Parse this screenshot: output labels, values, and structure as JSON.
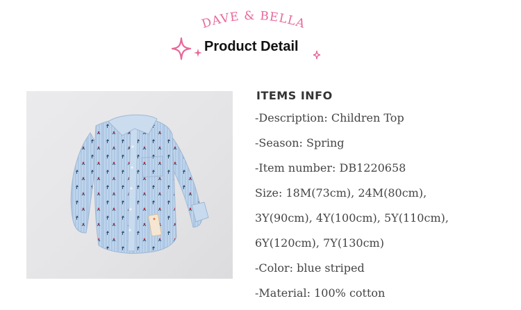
{
  "brand": "DAVE & BELLA",
  "title": "Product Detail",
  "colors": {
    "brand_pink": "#e8689a",
    "shirt_blue": "#b7cfe8"
  },
  "icons": [
    "sparkle-icon"
  ],
  "info": {
    "heading": "ITEMS INFO",
    "description": "-Description: Children Top",
    "season": "-Season: Spring",
    "item_number": "-Item number: DB1220658",
    "size_1": "Size:  18M(73cm), 24M(80cm),",
    "size_2": "3Y(90cm), 4Y(100cm), 5Y(110cm),",
    "size_3": "6Y(120cm), 7Y(130cm)",
    "color": "-Color: blue striped",
    "material": "-Material: 100% cotton"
  }
}
